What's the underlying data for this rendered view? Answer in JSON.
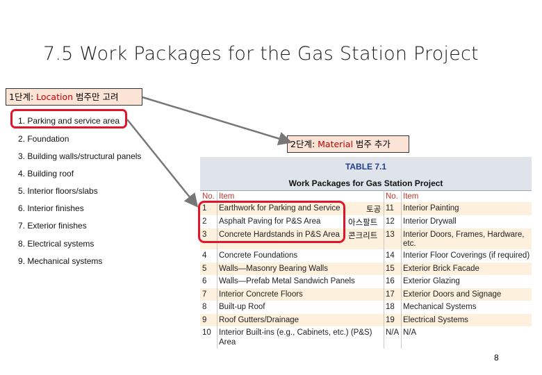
{
  "title": "7.5 Work Packages for the Gas Station Project",
  "step1": {
    "prefix": "1단계: ",
    "keyword": "Location",
    "suffix": " 범주만 고려"
  },
  "step2": {
    "prefix": "2단계: ",
    "keyword": "Material",
    "suffix": " 범주 추가"
  },
  "list": [
    "1. Parking and service area",
    "2. Foundation",
    "3. Building walls/structural panels",
    "4. Building roof",
    "5. Interior floors/slabs",
    "6. Interior finishes",
    "7. Exterior finishes",
    "8. Electrical systems",
    "9. Mechanical systems"
  ],
  "table": {
    "caption": "TABLE 7.1",
    "subtitle": "Work Packages for Gas Station Project",
    "headers": {
      "no1": "No.",
      "item1": "Item",
      "no2": "No.",
      "item2": "Item"
    },
    "rows": [
      {
        "no1": "1",
        "item1": "Earthwork for Parking and Service",
        "no2": "11",
        "item2": "Interior Painting"
      },
      {
        "no1": "2",
        "item1": "Asphalt Paving for P&S Area",
        "no2": "12",
        "item2": "Interior Drywall"
      },
      {
        "no1": "3",
        "item1": "Concrete Hardstands in P&S Area",
        "no2": "13",
        "item2": "Interior Doors, Frames, Hardware,",
        "item2b": "etc."
      },
      {
        "no1": "4",
        "item1": "Concrete Foundations",
        "no2": "14",
        "item2": "Interior Floor Coverings (if required)"
      },
      {
        "no1": "5",
        "item1": "Walls—Masonry Bearing Walls",
        "no2": "15",
        "item2": "Exterior Brick Facade"
      },
      {
        "no1": "6",
        "item1": "Walls—Prefab Metal Sandwich Panels",
        "no2": "16",
        "item2": "Exterior Glazing"
      },
      {
        "no1": "7",
        "item1": "Interior Concrete Floors",
        "no2": "17",
        "item2": "Exterior Doors and Signage"
      },
      {
        "no1": "8",
        "item1": "Built-up Roof",
        "no2": "18",
        "item2": "Mechanical Systems"
      },
      {
        "no1": "9",
        "item1": "Roof Gutters/Drainage",
        "no2": "19",
        "item2": "Electrical Systems"
      },
      {
        "no1": "10",
        "item1": "Interior Built-ins (e.g., Cabinets, etc.) (P&S)",
        "item1b": "Area",
        "no2": "N/A",
        "item2": "N/A"
      }
    ]
  },
  "korean_labels": [
    "토공",
    "아스팔트",
    "콘크리트"
  ],
  "page_number": "8",
  "colors": {
    "highlight": "#c00000",
    "label_bg": "#fbe3d6",
    "red_box": "#e0142a",
    "table_header_text": "#c0392b"
  }
}
